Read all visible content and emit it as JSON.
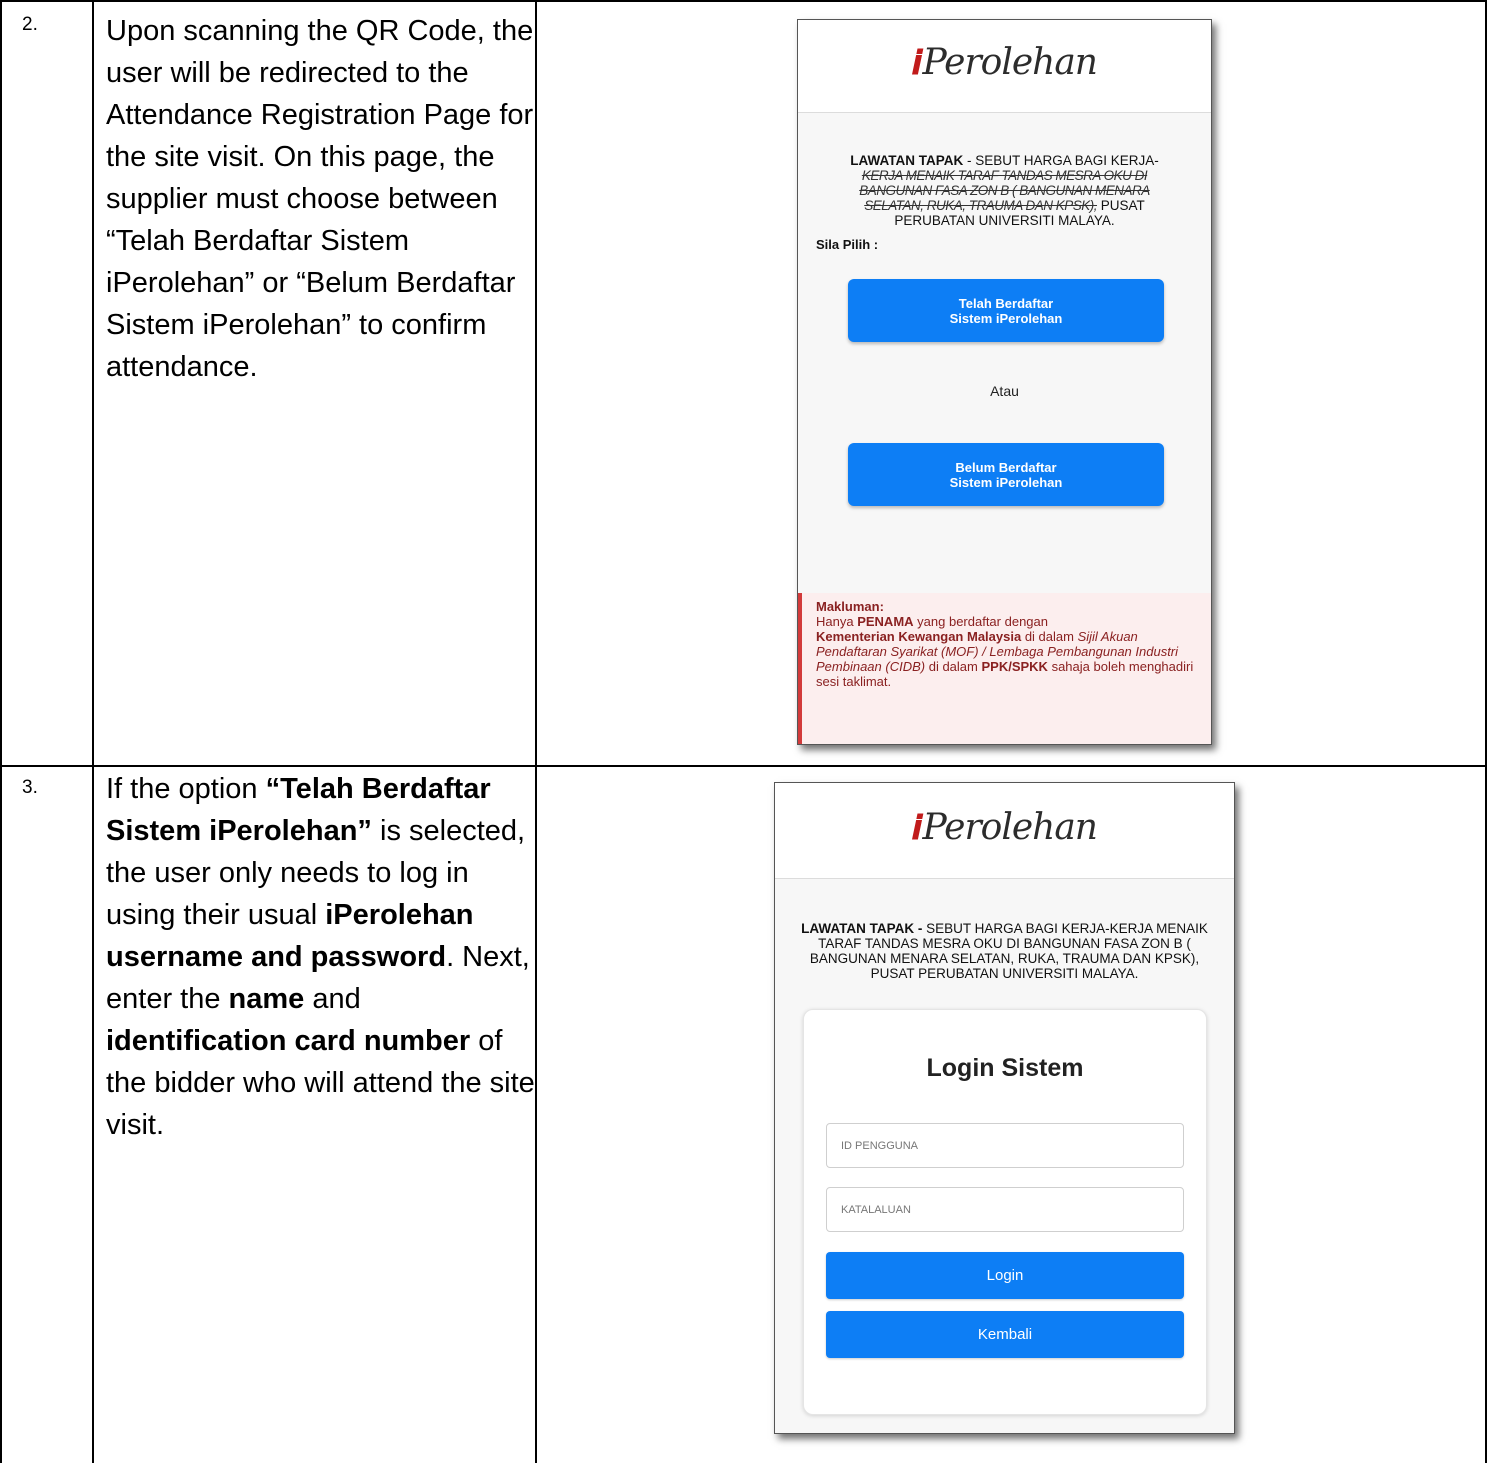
{
  "rows": [
    {
      "number": "2.",
      "description_parts": [
        {
          "text": "Upon scanning the QR Code, the user will be redirected to the Attendance Registration Page for the site visit. On this page, the supplier must choose between “Telah Berdaftar Sistem iPerolehan” or “Belum Berdaftar Sistem iPerolehan” to confirm attendance.",
          "bold": false
        }
      ],
      "screen": {
        "logo_text": "Perolehan",
        "notice_bold": "LAWATAN TAPAK",
        "notice_rest_line1": " - SEBUT HARGA BAGI KERJA-",
        "notice_scrambled_1": "KERJA MENAIK TARAF TANDAS MESRA OKU DI",
        "notice_scrambled_2": "BANGUNAN FASA ZON B ( BANGUNAN MENARA",
        "notice_scrambled_3": "SELATAN, RUKA, TRAUMA DAN KPSK),",
        "notice_line3_end": " PUSAT",
        "notice_line4": "PERUBATAN UNIVERSITI MALAYA.",
        "sila_pilih": "Sila Pilih :",
        "btn_registered_line1": "Telah Berdaftar",
        "btn_registered_line2": "Sistem iPerolehan",
        "atau": "Atau",
        "btn_unregistered_line1": "Belum Berdaftar",
        "btn_unregistered_line2": "Sistem iPerolehan",
        "makluman_title": "Makluman:",
        "makluman_1": "Hanya ",
        "makluman_penama": "PENAMA",
        "makluman_2": " yang berdaftar dengan",
        "makluman_kementerian": "Kementerian Kewangan Malaysia",
        "makluman_3": " di dalam ",
        "makluman_sijil": "Sijil Akuan Pendaftaran Syarikat (MOF) / Lembaga Pembangunan Industri Pembinaan (CIDB)",
        "makluman_4": " di dalam ",
        "makluman_ppk": "PPK/SPKK",
        "makluman_5": " sahaja boleh menghadiri sesi taklimat."
      }
    },
    {
      "number": "3.",
      "description": {
        "p1": "If the option ",
        "p2_bold": "“Telah Berdaftar Sistem iPerolehan”",
        "p3": " is selected, the user only needs to log in using their usual ",
        "p4_bold": "iPerolehan username and password",
        "p5": ". Next, enter the ",
        "p6_bold": "name",
        "p7": " and ",
        "p8_bold": "identification card number",
        "p9": " of the bidder who will attend the site visit."
      },
      "screen": {
        "logo_text": "Perolehan",
        "notice_bold": "LAWATAN TAPAK -",
        "notice_rest": " SEBUT HARGA BAGI KERJA-KERJA MENAIK TARAF TANDAS MESRA OKU DI BANGUNAN FASA ZON B ( BANGUNAN MENARA SELATAN, RUKA, TRAUMA DAN KPSK), PUSAT PERUBATAN UNIVERSITI MALAYA.",
        "login_title": "Login Sistem",
        "username_placeholder": "ID PENGGUNA",
        "password_placeholder": "KATALALUAN",
        "login_btn": "Login",
        "back_btn": "Kembali"
      }
    }
  ],
  "colors": {
    "button_blue": "#0d7ef5",
    "notice_bg": "#fceeee",
    "notice_border": "#d23a3a",
    "notice_text": "#8a2121",
    "logo_mark": "#c11b1b"
  }
}
